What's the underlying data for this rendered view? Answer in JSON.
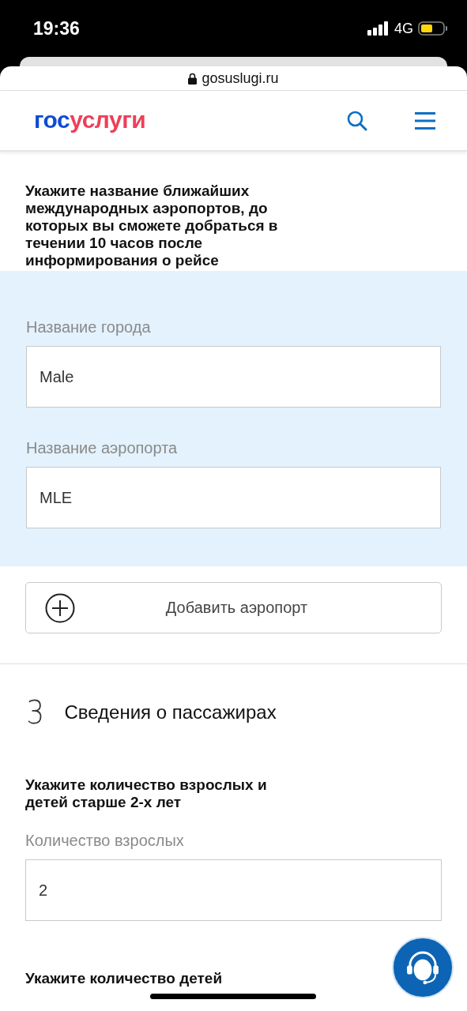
{
  "status_bar": {
    "time": "19:36",
    "network": "4G"
  },
  "browser": {
    "url": "gosuslugi.ru"
  },
  "header": {
    "logo": [
      "гос",
      "услуги"
    ]
  },
  "airports": {
    "question": "Укажите название ближайших международных аэропортов, до которых вы сможете добраться в течении 10 часов после информирования о рейсе",
    "fields": [
      {
        "label": "Название города",
        "value": "Male"
      },
      {
        "label": "Название аэропорта",
        "value": "MLE"
      }
    ],
    "add_button": "Добавить аэропорт"
  },
  "section": {
    "number": "3",
    "title": "Сведения о пассажирах"
  },
  "passengers": {
    "question": "Укажите количество взрослых и детей старше 2-х лет",
    "fields": [
      {
        "label": "Количество взрослых",
        "value": "2"
      }
    ],
    "next_question": "Укажите количество детей"
  }
}
